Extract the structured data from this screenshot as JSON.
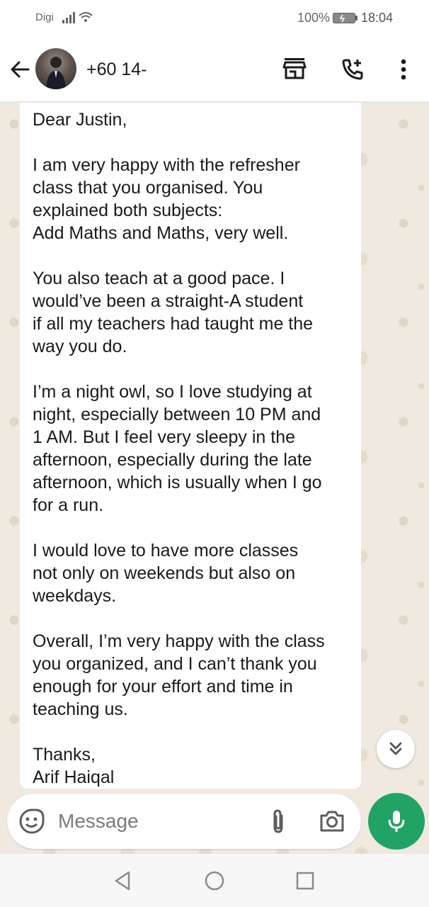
{
  "status_bar": {
    "carrier": "Digi",
    "battery_percent": "100%",
    "time": "18:04"
  },
  "header": {
    "contact_name": "+60 14-",
    "icons": [
      "back-arrow-icon",
      "storefront-icon",
      "add-call-icon",
      "more-vert-icon"
    ]
  },
  "message": {
    "paragraphs": [
      "Dear Justin,",
      "I am very happy with the refresher\nclass that you organised. You\nexplained both subjects:\nAdd Maths and Maths, very well.",
      "You also teach at a good pace. I\nwould’ve been a straight-A student\nif all my teachers had taught me the\nway you do.",
      "I’m a night owl, so I love studying at\nnight, especially between 10 PM and\n1 AM. But I feel very sleepy in the\nafternoon, especially during the late\nafternoon, which is usually when I go\nfor a run.",
      "I would love to have more classes\nnot only on weekends but also on\nweekdays.",
      "Overall, I’m very happy with the class\nyou organized, and I can’t thank you\nenough for your effort and time in\nteaching us.",
      "Thanks,\nArif Haiqal"
    ]
  },
  "composer": {
    "placeholder": "Message",
    "value": ""
  },
  "colors": {
    "accent_green": "#21a366",
    "chat_background": "#efe9df",
    "bubble": "#ffffff"
  }
}
